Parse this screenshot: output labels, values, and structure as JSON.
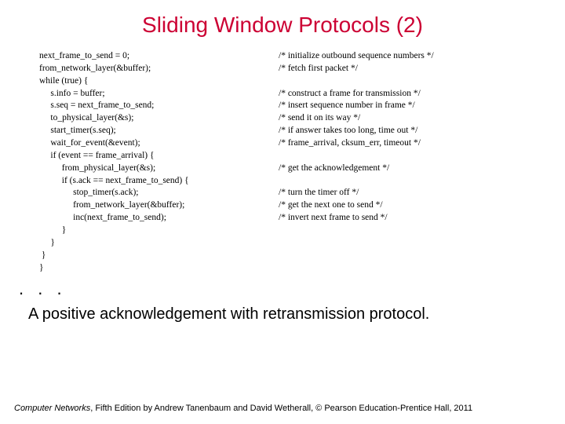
{
  "title": "Sliding Window Protocols (2)",
  "code": {
    "l01s": "next_frame_to_send = 0;",
    "l01c": "/* initialize outbound sequence numbers */",
    "l02s": "from_network_layer(&buffer);",
    "l02c": "/* fetch first packet */",
    "l03s": "while (true) {",
    "l03c": "",
    "l04s": "     s.info = buffer;",
    "l04c": "/* construct a frame for transmission */",
    "l05s": "     s.seq = next_frame_to_send;",
    "l05c": "/* insert sequence number in frame */",
    "l06s": "     to_physical_layer(&s);",
    "l06c": "/* send it on its way */",
    "l07s": "     start_timer(s.seq);",
    "l07c": "/* if answer takes too long, time out */",
    "l08s": "     wait_for_event(&event);",
    "l08c": "/* frame_arrival, cksum_err, timeout */",
    "l09s": "     if (event == frame_arrival) {",
    "l09c": "",
    "l10s": "          from_physical_layer(&s);",
    "l10c": "/* get the acknowledgement */",
    "l11s": "          if (s.ack == next_frame_to_send) {",
    "l11c": "",
    "l12s": "               stop_timer(s.ack);",
    "l12c": "/* turn the timer off */",
    "l13s": "               from_network_layer(&buffer);",
    "l13c": "/* get the next one to send */",
    "l14s": "               inc(next_frame_to_send);",
    "l14c": "/* invert next frame to send */",
    "l15s": "          }",
    "l15c": "",
    "l16s": "     }",
    "l16c": "",
    "l17s": " }",
    "l17c": "",
    "l18s": "}",
    "l18c": ""
  },
  "ellipsis": ". . .",
  "caption": "A positive acknowledgement with retransmission protocol.",
  "footer_book": "Computer Networks",
  "footer_rest": ", Fifth Edition by Andrew Tanenbaum and David Wetherall, © Pearson Education-Prentice Hall, 2011"
}
